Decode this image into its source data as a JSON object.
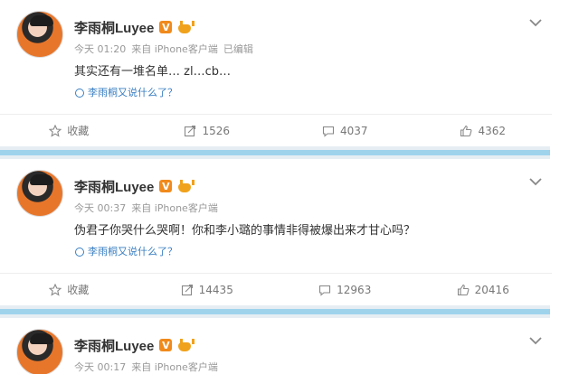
{
  "posts": [
    {
      "author": "李雨桐Luyee",
      "verified_label": "V",
      "time": "今天 01:20",
      "source": "来自 iPhone客户端",
      "edited": "已编辑",
      "text": "其实还有一堆名单… zl…cb…",
      "topic": "李雨桐又说什么了？",
      "actions": {
        "collect": "收藏",
        "repost": "1526",
        "comment": "4037",
        "like": "4362"
      }
    },
    {
      "author": "李雨桐Luyee",
      "verified_label": "V",
      "time": "今天 00:37",
      "source": "来自 iPhone客户端",
      "text": "伪君子你哭什么哭啊！你和李小璐的事情非得被爆出来才甘心吗？",
      "topic": "李雨桐又说什么了？",
      "actions": {
        "collect": "收藏",
        "repost": "14435",
        "comment": "12963",
        "like": "20416"
      }
    },
    {
      "author": "李雨桐Luyee",
      "verified_label": "V",
      "time": "今天 00:17",
      "source": "来自 iPhone客户端"
    }
  ],
  "colors": {
    "link": "#3a7fc2",
    "badge": "#f08a1c",
    "separator": "#9fd3ec"
  },
  "icons": [
    "avatar",
    "verified-v-icon",
    "crown-icon",
    "chevron-down-icon",
    "topic-icon",
    "star-icon",
    "repost-icon",
    "comment-icon",
    "like-icon"
  ]
}
